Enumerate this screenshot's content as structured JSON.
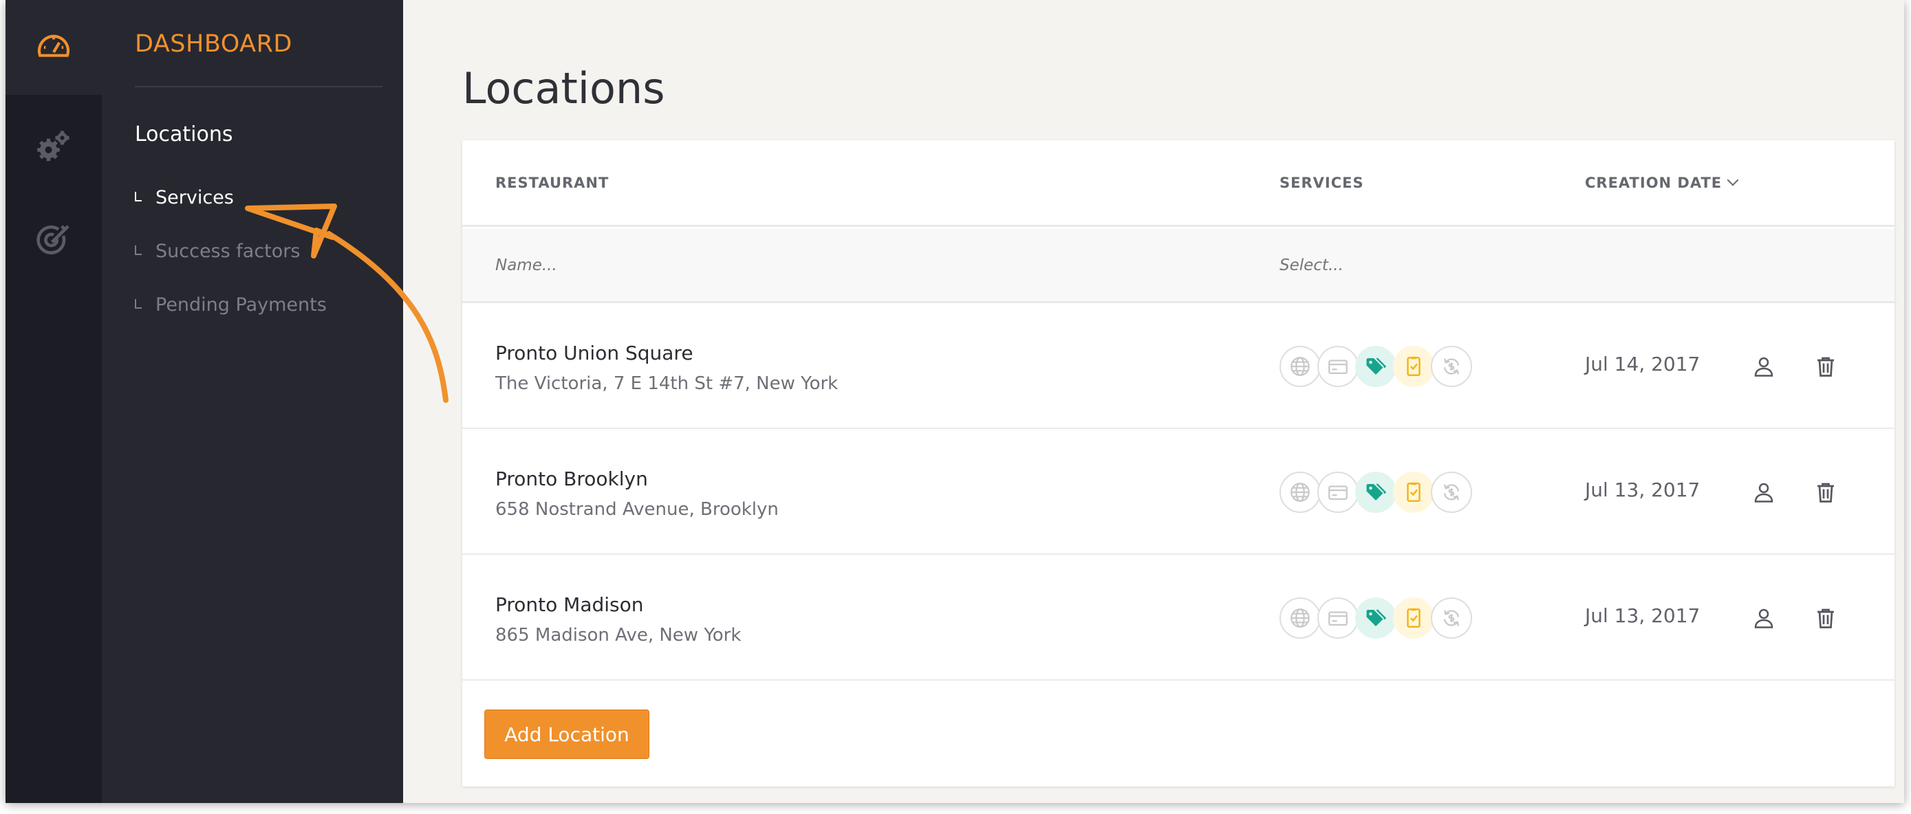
{
  "colors": {
    "accent": "#f0912c",
    "teal": "#16a58c",
    "gold": "#f2b619"
  },
  "sidebar": {
    "brand": "DASHBOARD",
    "main_item": "Locations",
    "items": [
      {
        "label": "Services",
        "active": true
      },
      {
        "label": "Success factors",
        "active": false
      },
      {
        "label": "Pending Payments",
        "active": false
      }
    ]
  },
  "rail": {
    "icons": [
      "speedometer-icon",
      "gears-icon",
      "target-icon"
    ]
  },
  "page": {
    "title": "Locations"
  },
  "table": {
    "columns": {
      "restaurant": "RESTAURANT",
      "services": "SERVICES",
      "creation_date": "CREATION DATE"
    },
    "filters": {
      "name_placeholder": "Name...",
      "services_placeholder": "Select..."
    },
    "service_icons": [
      "globe-icon",
      "credit-card-icon",
      "tag-icon",
      "clipboard-check-icon",
      "refresh-dollar-icon"
    ],
    "rows": [
      {
        "name": "Pronto Union Square",
        "address": "The Victoria, 7 E 14th St #7, New York",
        "date": "Jul 14, 2017"
      },
      {
        "name": "Pronto Brooklyn",
        "address": "658 Nostrand Avenue, Brooklyn",
        "date": "Jul 13, 2017"
      },
      {
        "name": "Pronto Madison",
        "address": "865 Madison Ave, New York",
        "date": "Jul 13, 2017"
      }
    ]
  },
  "actions": {
    "add_location": "Add Location"
  }
}
